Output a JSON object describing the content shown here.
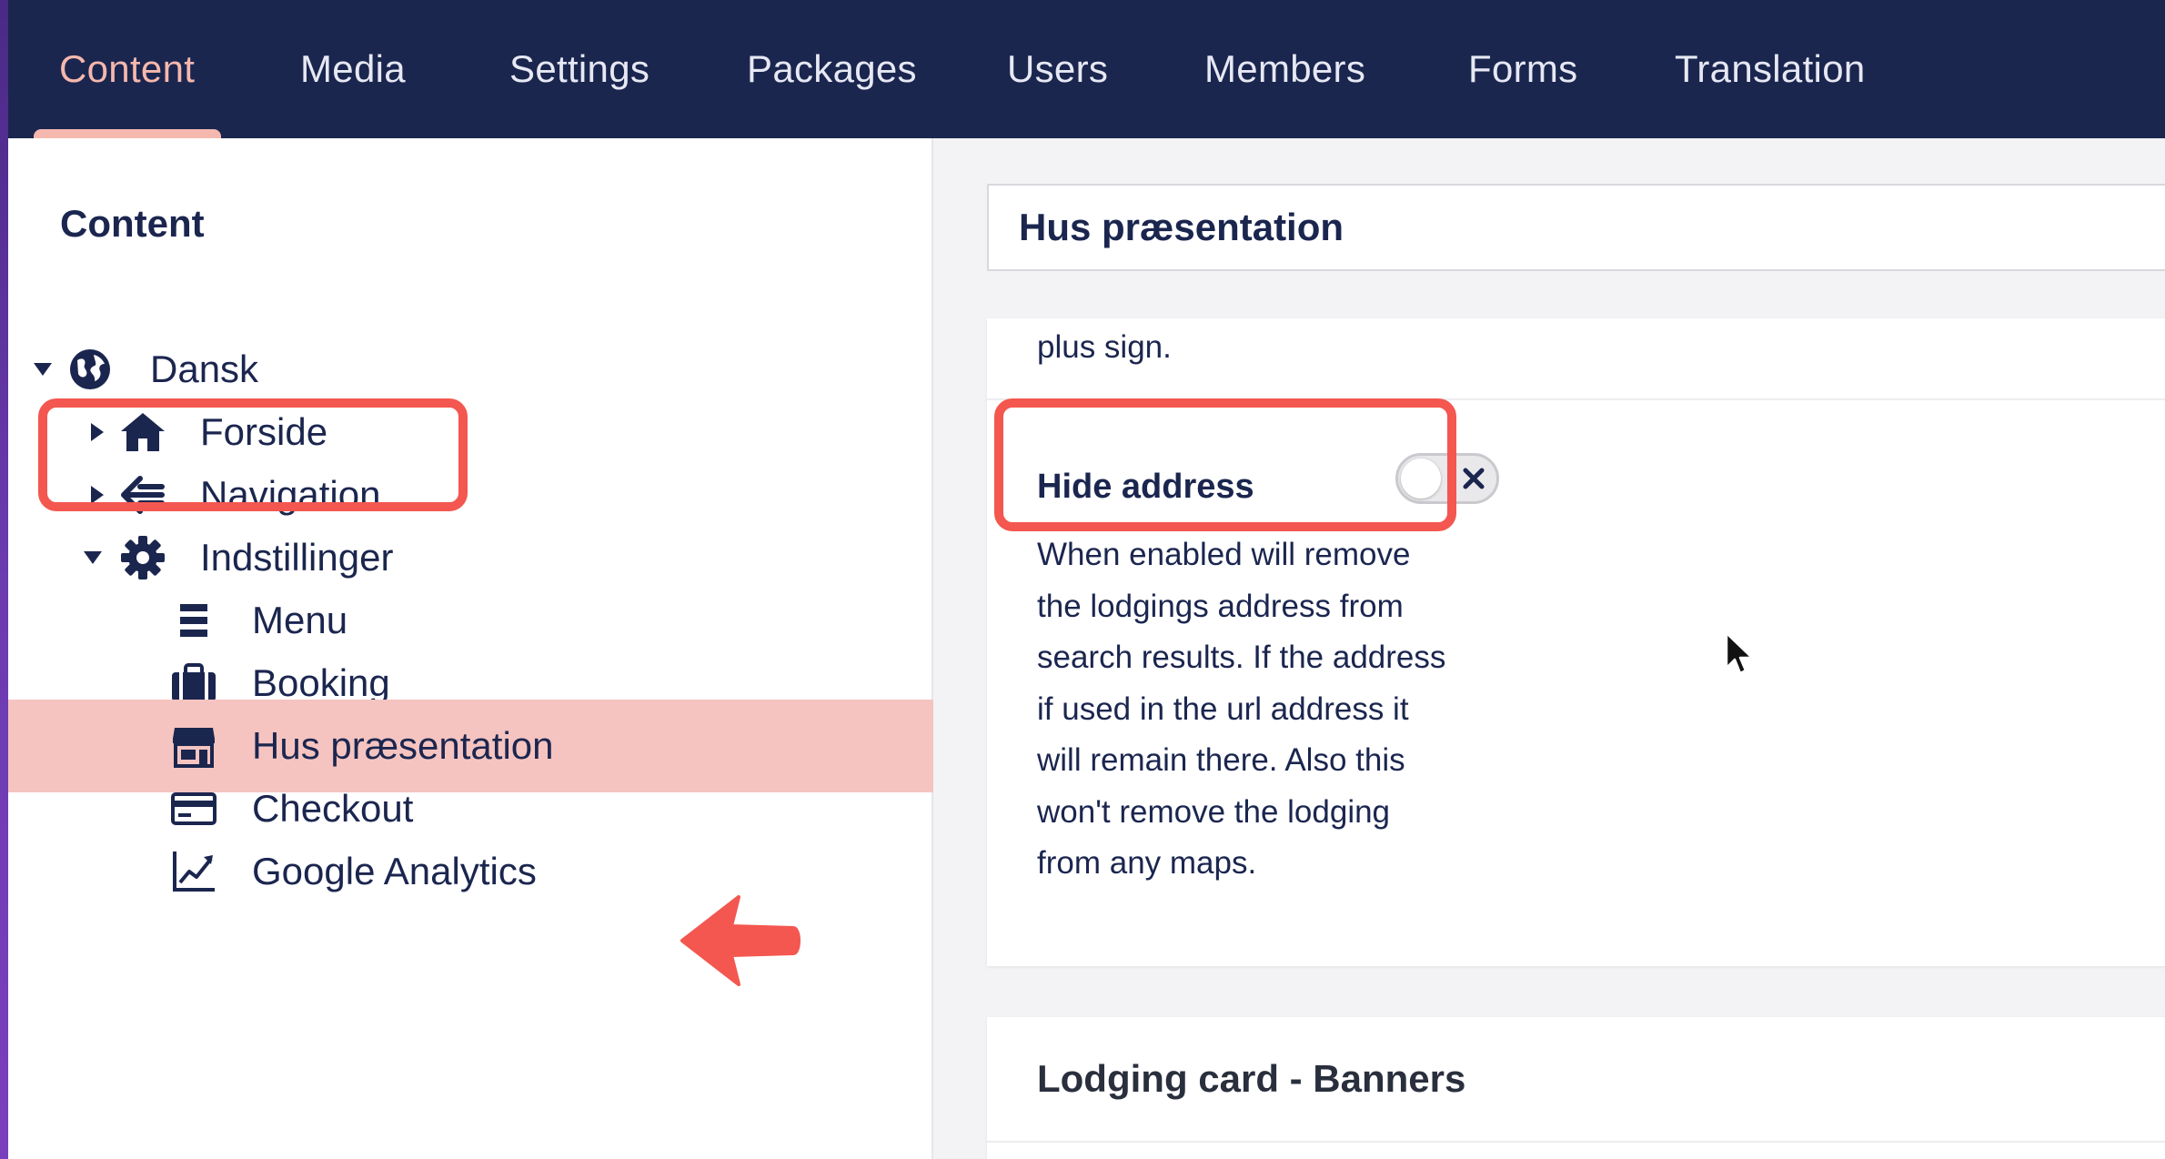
{
  "nav": {
    "tabs": [
      "Content",
      "Media",
      "Settings",
      "Packages",
      "Users",
      "Members",
      "Forms",
      "Translation"
    ],
    "active": "Content"
  },
  "sidebar": {
    "title": "Content",
    "tree": [
      {
        "label": "Dansk",
        "icon": "globe-icon",
        "caret": "expanded"
      },
      {
        "label": "Forside",
        "icon": "home-icon",
        "caret": "collapsed"
      },
      {
        "label": "Navigation",
        "icon": "navigation-icon",
        "caret": "collapsed"
      },
      {
        "label": "Indstillinger",
        "icon": "gear-icon",
        "caret": "expanded"
      },
      {
        "label": "Menu",
        "icon": "menu-list-icon"
      },
      {
        "label": "Booking",
        "icon": "briefcase-icon"
      },
      {
        "label": "Hus præsentation",
        "icon": "store-icon",
        "selected": true
      },
      {
        "label": "Checkout",
        "icon": "credit-card-icon"
      },
      {
        "label": "Google Analytics",
        "icon": "chart-line-icon"
      }
    ]
  },
  "editor": {
    "node_name": "Hus præsentation",
    "prev_description_tail": "plus sign.",
    "property": {
      "label": "Hide address",
      "toggle_on": false,
      "help_lines": [
        "When enabled will remove",
        "the lodgings address from",
        "search results. If the address",
        "if used in the url address it",
        "will remain there. Also this",
        "won't remove the lodging",
        "from any maps."
      ]
    },
    "next_group_title": "Lodging card - Banners"
  },
  "colors": {
    "nav_bg": "#1b264f",
    "nav_active": "#f5b8ae",
    "selected_row": "#f5c4c0",
    "annotation_red": "#f3574f"
  }
}
